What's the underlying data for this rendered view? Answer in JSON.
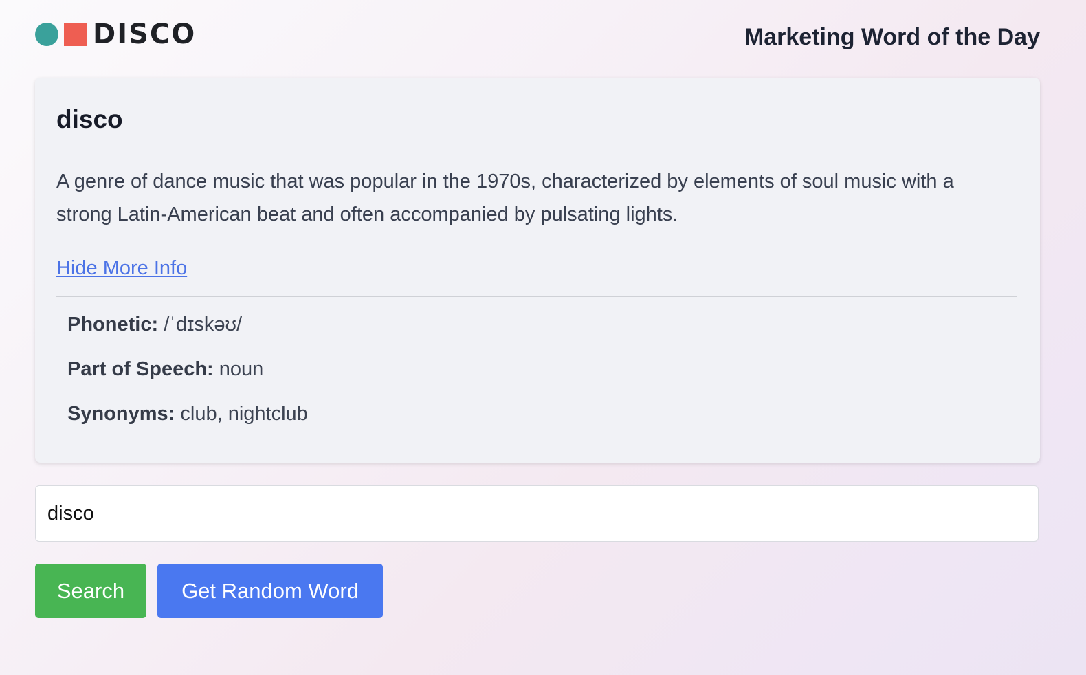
{
  "header": {
    "logo_text": "DISCO",
    "title": "Marketing Word of the Day"
  },
  "card": {
    "word": "disco",
    "definition": "A genre of dance music that was popular in the 1970s, characterized by elements of soul music with a strong Latin-American beat and often accompanied by pulsating lights.",
    "toggle_label": "Hide More Info",
    "details": {
      "phonetic_label": "Phonetic:",
      "phonetic_value": "/ˈdɪskəʊ/",
      "pos_label": "Part of Speech:",
      "pos_value": "noun",
      "synonyms_label": "Synonyms:",
      "synonyms_value": "club, nightclub"
    }
  },
  "search": {
    "value": "disco",
    "search_label": "Search",
    "random_label": "Get Random Word"
  },
  "colors": {
    "logo_circle": "#3aa19b",
    "logo_square": "#ee5e52",
    "link": "#4c73e6",
    "search_button": "#48b553",
    "random_button": "#4a78f0"
  },
  "icons": {
    "logo_circle": "circle-icon",
    "logo_square": "square-icon"
  }
}
